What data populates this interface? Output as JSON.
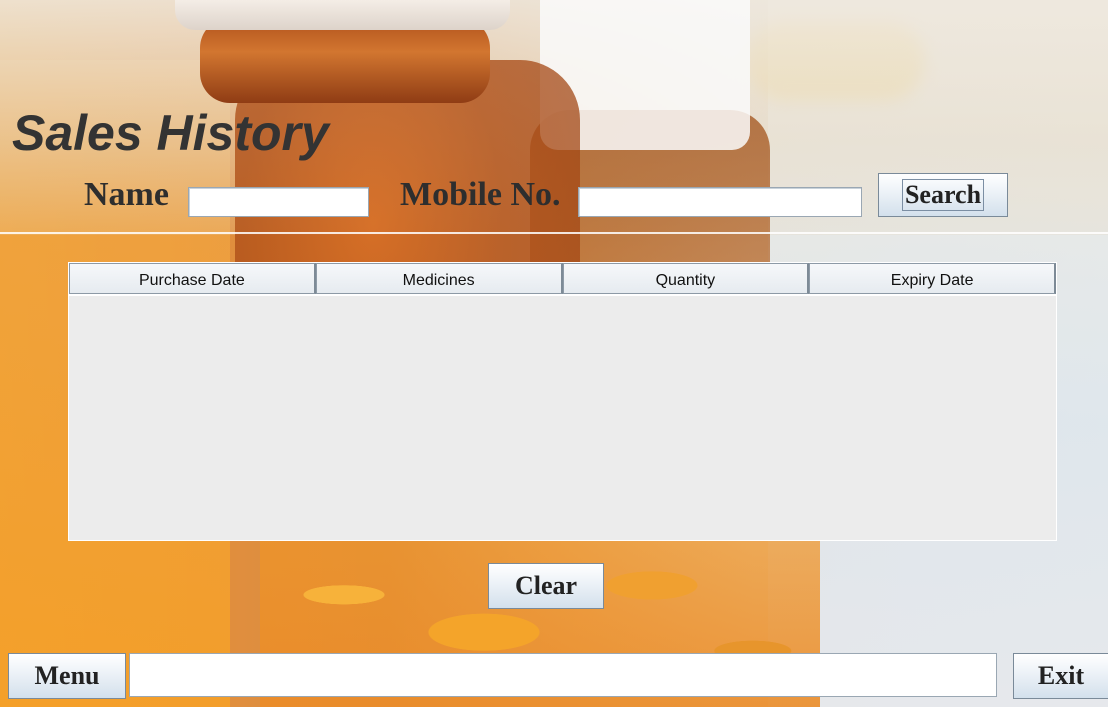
{
  "window": {
    "title": "Sales History"
  },
  "search_form": {
    "name_label": "Name",
    "name_value": "",
    "mobile_label": "Mobile No.",
    "mobile_value": "",
    "search_label": "Search"
  },
  "table": {
    "columns": [
      "Purchase Date",
      "Medicines",
      "Quantity",
      "Expiry Date"
    ],
    "rows": []
  },
  "actions": {
    "clear_label": "Clear",
    "menu_label": "Menu",
    "exit_label": "Exit",
    "status_text": ""
  }
}
